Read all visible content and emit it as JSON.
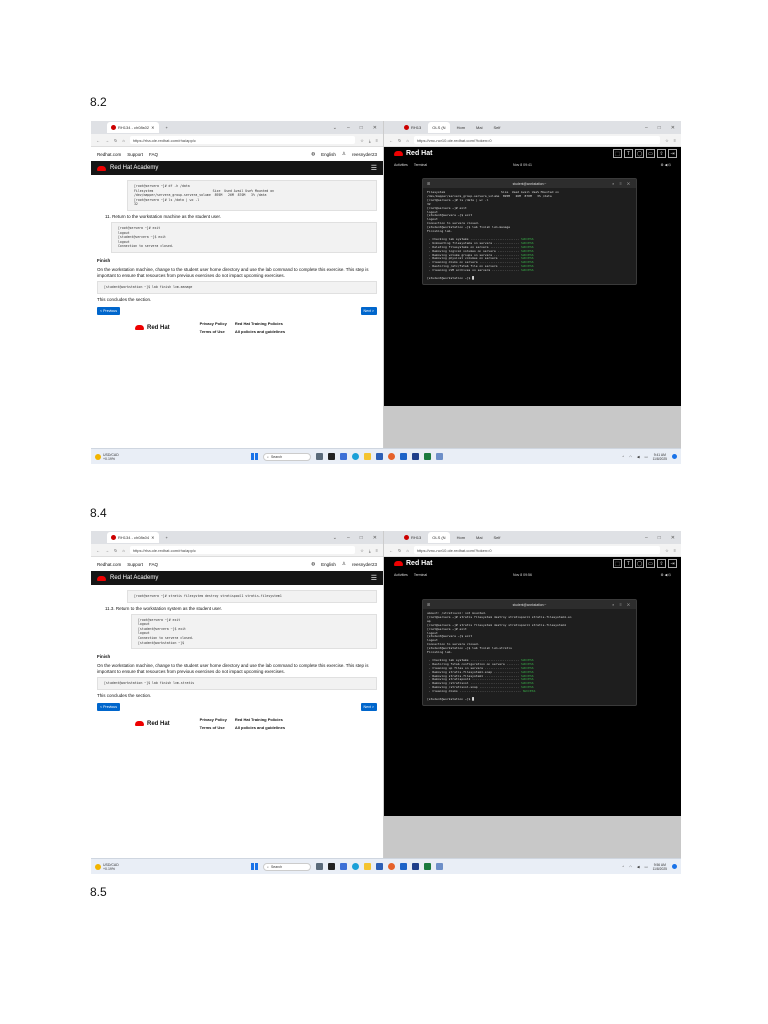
{
  "sections": [
    {
      "heading": "8.2",
      "left": {
        "tab_title": "RH134 - ch08s02",
        "url": "https://rha.ole.redhat.com/rha/app/c",
        "top_links": [
          "Redhat.com",
          "Support",
          "FAQ"
        ],
        "language": "English",
        "user": "reesnyder23",
        "brand": "Red Hat Academy",
        "code1": "[root@servera ~]# df -h /data\nFilesystem                               Size  Used Avail Use% Mounted on\n/dev/mapper/servera_group-servera_volume  895M   26M  870M   3% /data\n[root@servera ~]# ls /data | wc -l\n32",
        "step": "11.  Return to the workstation machine as the student user.",
        "code2": "[root@servera ~]# exit\nlogout\n[student@servera ~]$ exit\nlogout\nConnection to servera closed.",
        "finish_heading": "Finish",
        "finish_text": "On the workstation machine, change to the student user home directory and use the lab command to complete this exercise. This step is important to ensure that resources from previous exercises do not impact upcoming exercises.",
        "finish_cmd": "[student@workstation ~]$ lab finish lvm-manage",
        "conclude": "This concludes the section.",
        "prev": "< Previous",
        "next": "Next >",
        "footer_brand": "Red Hat",
        "footer_links": [
          "Privacy Policy",
          "Red Hat Training Policies",
          "Terms of Use",
          "All policies and guidelines"
        ]
      },
      "right": {
        "tabs": [
          "RH13",
          "OLS (N",
          "Hom",
          "Mai",
          "Self"
        ],
        "url": "https://vnc-ncr10.ole.redhat.com/?token=0",
        "brand": "Red Hat",
        "activities": "Activities",
        "terminal_app": "Terminal",
        "clock": "Nov 8  09:41",
        "term_title": "student@workstation:~",
        "lines": [
          "Filesystem                               Size  Used Avail Use% Mounted on",
          "/dev/mapper/servera_group-servera_volume  895M   26M  870M   3% /data",
          "[root@servera ~]# ls /data | wc -l",
          "32",
          "[root@servera ~]# exit",
          "logout",
          "[student@servera ~]$ exit",
          "logout",
          "Connection to servera closed.",
          "[student@workstation ~]$ lab finish lvm-manage",
          "",
          "Finishing lab.",
          ""
        ],
        "checks": [
          " · Checking lab systems ...........................",
          " · Unmounting filesystems on servera ..............",
          " · Deleting filesystems on servera ................",
          " · Removing logical volumes on servera ............",
          " · Removing volume groups on servera ..............",
          " · Removing physical volumes on servera ...........",
          " · Cleaning disks on servera ......................",
          " · Restoring /etc/fstab file on servera ...........",
          " · Cleaning LVM archives on servera ..............."
        ],
        "success": "SUCCESS",
        "prompt": "[student@workstation ~]$ █"
      },
      "taskbar": {
        "weather_pair": "USD/CAD",
        "weather_change": "+0.19%",
        "search": "Search",
        "time": "9:41 AM",
        "date": "11/8/2025"
      }
    },
    {
      "heading": "8.4",
      "left": {
        "tab_title": "RH134 - ch08s04",
        "url": "https://rha.ole.redhat.com/rha/app/c",
        "top_links": [
          "Redhat.com",
          "Support",
          "FAQ"
        ],
        "language": "English",
        "user": "reesnyder23",
        "brand": "Red Hat Academy",
        "code1": "[root@servera ~]# stratis filesystem destroy stratispool1 stratis-filesystem1",
        "step": "11.3.  Return to the workstation system as the student user.",
        "code2": "[root@servera ~]# exit\nlogout\n[student@servera ~]$ exit\nlogout\nConnection to servera closed.\n[student@workstation ~]$",
        "finish_heading": "Finish",
        "finish_text": "On the workstation machine, change to the student user home directory and use the lab command to complete this exercise. This step is important to ensure that resources from previous exercises do not impact upcoming exercises.",
        "finish_cmd": "[student@workstation ~]$ lab finish lvm-stratis",
        "conclude": "This concludes the section.",
        "prev": "< Previous",
        "next": "Next >",
        "footer_brand": "Red Hat",
        "footer_links": [
          "Privacy Policy",
          "Red Hat Training Policies",
          "Terms of Use",
          "All policies and guidelines"
        ]
      },
      "right": {
        "tabs": [
          "RH13",
          "OLS (N",
          "Hom",
          "Mai",
          "Self"
        ],
        "url": "https://vnc-ncr10.ole.redhat.com/?token=0",
        "brand": "Red Hat",
        "activities": "Activities",
        "terminal_app": "Terminal",
        "clock": "Nov 8  09:56",
        "term_title": "student@workstation:~",
        "lines": [
          "umount: /stratisvol: not mounted.",
          "[root@servera ~]# stratis filesystem destroy stratispool1 stratis-filesystem1-sn",
          "ap",
          "[root@servera ~]# stratis filesystem destroy stratispool1 stratis-filesystem1",
          "[root@servera ~]# exit",
          "logout",
          "[student@servera ~]$ exit",
          "logout",
          "Connection to servera closed.",
          "[student@workstation ~]$ lab finish lvm-stratis",
          "",
          "Finishing lab.",
          ""
        ],
        "checks": [
          " · Checking lab systems ...........................",
          " · Restoring fstab configuration on servera .......",
          " · Cleaning up files on servera ...................",
          " · Removing stratis-filesystem1-snap ..............",
          " · Removing stratis-filesystem1 ...................",
          " · Removing stratispool1 ..........................",
          " · Removing /stratisvol ...........................",
          " · Removing /stratisvol-snap ......................",
          " · Cleaning disks .................................."
        ],
        "success": "SUCCESS",
        "prompt": "[student@workstation ~]$ █"
      },
      "taskbar": {
        "weather_pair": "USD/CAD",
        "weather_change": "+0.19%",
        "search": "Search",
        "time": "9:56 AM",
        "date": "11/8/2025"
      }
    }
  ],
  "trailing_heading": "8.5"
}
